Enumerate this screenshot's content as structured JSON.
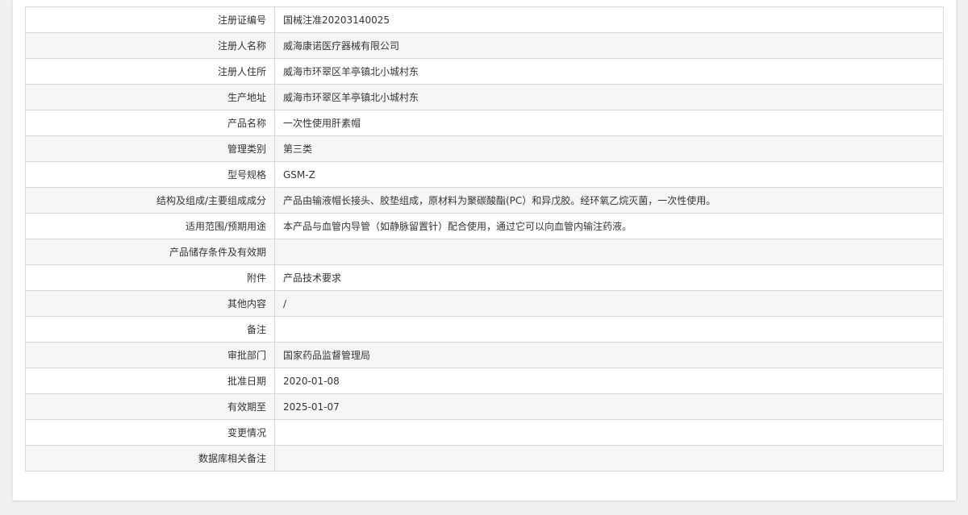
{
  "record": {
    "rows": [
      {
        "label": "注册证编号",
        "value": "国械注准20203140025"
      },
      {
        "label": "注册人名称",
        "value": "威海康诺医疗器械有限公司"
      },
      {
        "label": "注册人住所",
        "value": "威海市环翠区羊亭镇北小城村东"
      },
      {
        "label": "生产地址",
        "value": "威海市环翠区羊亭镇北小城村东"
      },
      {
        "label": "产品名称",
        "value": "一次性使用肝素帽"
      },
      {
        "label": "管理类别",
        "value": "第三类"
      },
      {
        "label": "型号规格",
        "value": "GSM-Z"
      },
      {
        "label": "结构及组成/主要组成成分",
        "value": "产品由输液帽长接头、胶垫组成，原材料为聚碳酸酯(PC）和异戊胶。经环氧乙烷灭菌，一次性使用。"
      },
      {
        "label": "适用范围/预期用途",
        "value": "本产品与血管内导管（如静脉留置针）配合使用，通过它可以向血管内输注药液。"
      },
      {
        "label": "产品储存条件及有效期",
        "value": ""
      },
      {
        "label": "附件",
        "value": "产品技术要求"
      },
      {
        "label": "其他内容",
        "value": "/"
      },
      {
        "label": "备注",
        "value": ""
      },
      {
        "label": "审批部门",
        "value": "国家药品监督管理局"
      },
      {
        "label": "批准日期",
        "value": "2020-01-08"
      },
      {
        "label": "有效期至",
        "value": "2025-01-07"
      },
      {
        "label": "变更情况",
        "value": ""
      },
      {
        "label": "数据库相关备注",
        "value": ""
      }
    ]
  }
}
